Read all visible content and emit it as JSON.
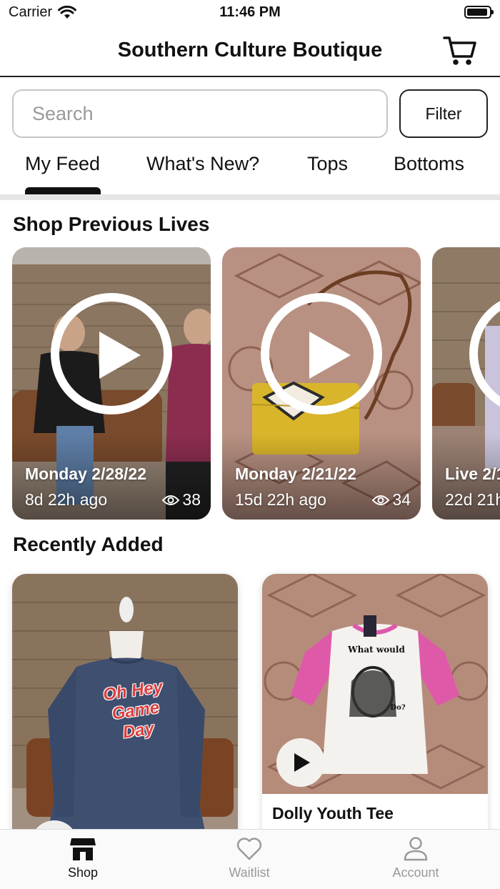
{
  "status_bar": {
    "carrier": "Carrier",
    "time": "11:46 PM"
  },
  "header": {
    "title": "Southern Culture Boutique"
  },
  "search": {
    "placeholder": "Search",
    "filter_label": "Filter"
  },
  "tabs": [
    {
      "label": "My Feed",
      "active": true
    },
    {
      "label": "What's New?",
      "active": false
    },
    {
      "label": "Tops",
      "active": false
    },
    {
      "label": "Bottoms",
      "active": false
    }
  ],
  "previous_lives": {
    "title": "Shop Previous Lives",
    "cards": [
      {
        "date": "Monday 2/28/22",
        "ago": "8d 22h ago",
        "views": "38"
      },
      {
        "date": "Monday 2/21/22",
        "ago": "15d 22h ago",
        "views": "34"
      },
      {
        "date": "Live 2/1",
        "ago": "22d 21h",
        "views": ""
      }
    ]
  },
  "recently_added": {
    "title": "Recently Added",
    "products": [
      {
        "name": "",
        "graphic_text": [
          "Oh Hey",
          "Game",
          "Day"
        ]
      },
      {
        "name": "Dolly Youth Tee",
        "graphic_text": [
          "What would",
          "Do?"
        ]
      }
    ]
  },
  "bottom_nav": [
    {
      "label": "Shop",
      "icon": "store-icon",
      "active": true
    },
    {
      "label": "Waitlist",
      "icon": "heart-icon",
      "active": false
    },
    {
      "label": "Account",
      "icon": "person-icon",
      "active": false
    }
  ],
  "colors": {
    "accent": "#111111",
    "inactive": "#9a9a9a"
  }
}
